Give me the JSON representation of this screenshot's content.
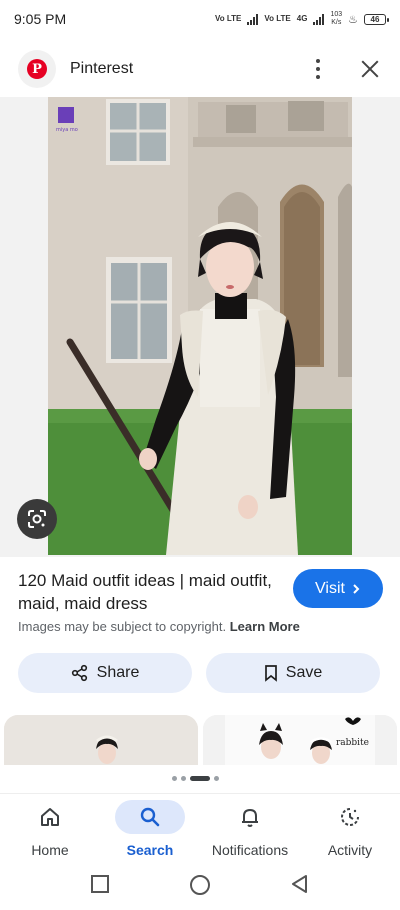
{
  "status_bar": {
    "time": "9:05 PM",
    "sim1": "Vo LTE",
    "sim2": "Vo LTE",
    "net": "4G",
    "speed_value": "103",
    "speed_unit": "K/s",
    "battery": "46"
  },
  "header": {
    "app_title": "Pinterest",
    "logo_letter": "P"
  },
  "image": {
    "watermark": "miya mo"
  },
  "result": {
    "title": "120 Maid outfit ideas | maid outfit, maid, maid dress",
    "visit_label": "Visit",
    "copyright_text": "Images may be subject to copyright.",
    "learn_more": "Learn More",
    "share_label": "Share",
    "save_label": "Save"
  },
  "related": {
    "thumb2_text": "rabbite"
  },
  "pager": {
    "count": 4,
    "active_index": 2
  },
  "bottom_nav": {
    "items": [
      {
        "label": "Home",
        "icon": "home-icon"
      },
      {
        "label": "Search",
        "icon": "search-icon",
        "active": true
      },
      {
        "label": "Notifications",
        "icon": "bell-icon"
      },
      {
        "label": "Activity",
        "icon": "activity-icon"
      }
    ]
  },
  "colors": {
    "accent": "#1a73e8",
    "active_tab": "#1a5fd0",
    "pill_bg": "#e8eefa",
    "brand": "#e60023"
  }
}
